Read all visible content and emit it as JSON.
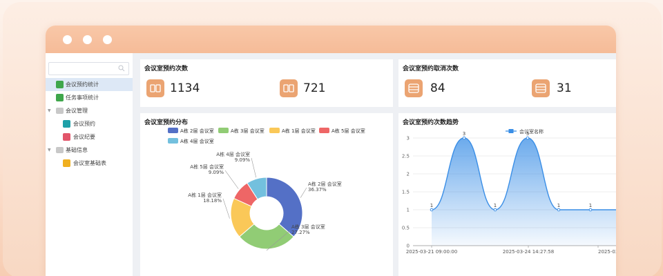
{
  "sidebar": {
    "search_placeholder": "",
    "items": [
      {
        "label": "会议预约统计",
        "icon": "bar-chart-icon",
        "active": true
      },
      {
        "label": "任务事项统计",
        "icon": "bar-chart-icon"
      },
      {
        "label": "会议管理",
        "icon": "folder-icon",
        "group": true
      },
      {
        "label": "会议预约",
        "icon": "send-icon"
      },
      {
        "label": "会议纪要",
        "icon": "note-icon"
      },
      {
        "label": "基础信息",
        "icon": "folder-icon",
        "group": true
      },
      {
        "label": "会议室基础表",
        "icon": "table-icon"
      }
    ]
  },
  "booking_card": {
    "title": "会议室预约次数",
    "stats": [
      "1134",
      "721"
    ]
  },
  "cancel_card": {
    "title": "会议室预约取消次数",
    "stats": [
      "84",
      "31"
    ]
  },
  "distribution_card": {
    "title": "会议室预约分布"
  },
  "trend_card": {
    "title": "会议室预约次数趋势"
  },
  "colors": {
    "accent": "#eba472",
    "series": [
      "#5470c6",
      "#91cc75",
      "#fac858",
      "#ee6666",
      "#73c0de"
    ],
    "line": "#3a8ee6"
  },
  "chart_data": [
    {
      "type": "pie",
      "title": "会议室预约分布",
      "legend": [
        "A栋 2层 会议室",
        "A栋 3层 会议室",
        "A栋 1层 会议室",
        "A栋 5层 会议室",
        "A栋 4层 会议室"
      ],
      "slices": [
        {
          "name": "A栋 2层 会议室",
          "percent": "36.37%",
          "value": 36.37
        },
        {
          "name": "A栋 3层 会议室",
          "percent": "27.27%",
          "value": 27.27
        },
        {
          "name": "A栋 1层 会议室",
          "percent": "18.18%",
          "value": 18.18
        },
        {
          "name": "A栋 5层 会议室",
          "percent": "9.09%",
          "value": 9.09
        },
        {
          "name": "A栋 4层 会议室",
          "percent": "9.09%",
          "value": 9.09
        }
      ],
      "legend_placement": "top"
    },
    {
      "type": "line",
      "title": "会议室预约次数趋势",
      "series": [
        {
          "name": "会议室名称",
          "values": [
            1,
            3,
            1,
            3,
            1,
            1,
            1
          ]
        }
      ],
      "x_labels": [
        "2025-03-21 09:00:00",
        "2025-03-24 14:27:58",
        "2025-03"
      ],
      "y_ticks": [
        "0",
        "0.5",
        "1",
        "1.5",
        "2",
        "2.5",
        "3"
      ],
      "ylim": [
        0,
        3
      ],
      "data_labels": [
        "1",
        "3",
        "1",
        "3",
        "1",
        "1"
      ],
      "legend_placement": "top",
      "grid": true
    }
  ]
}
